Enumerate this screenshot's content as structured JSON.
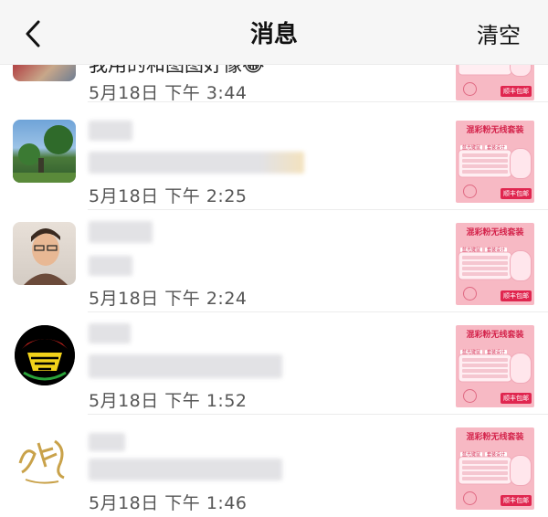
{
  "nav": {
    "title": "消息",
    "clear_label": "清空",
    "back_icon": "chevron-left-icon"
  },
  "product_card": {
    "title": "混彩粉无线套装",
    "tags": [
      "蓝光键鼠",
      "套装设计"
    ],
    "badge": "顺丰包邮",
    "accent": "#d4234b",
    "background": "#f7b9c4"
  },
  "messages": [
    {
      "preview": "我用的和图图好像😂",
      "time": "5月18日 下午 3:44",
      "avatar": "avatar-landscape"
    },
    {
      "preview": "",
      "time": "5月18日 下午 2:25",
      "avatar": "avatar-tree-sky"
    },
    {
      "preview": "",
      "time": "5月18日 下午 2:24",
      "avatar": "avatar-person"
    },
    {
      "preview": "",
      "time": "5月18日 下午 1:52",
      "avatar": "avatar-emblem"
    },
    {
      "preview": "",
      "time": "5月18日 下午 1:46",
      "avatar": "avatar-calligraphy"
    }
  ]
}
